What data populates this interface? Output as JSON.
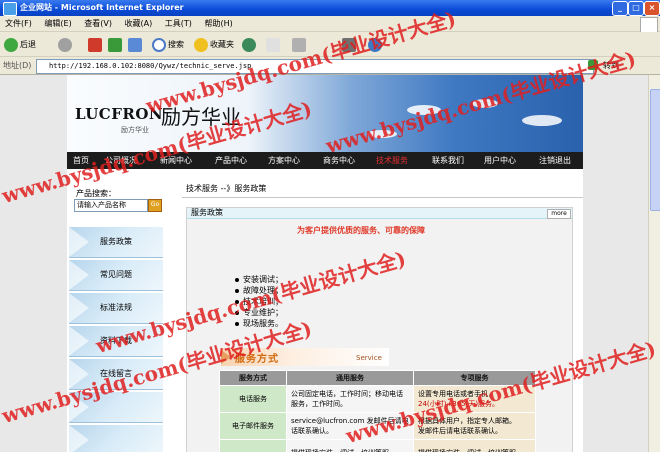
{
  "window": {
    "title": "企业网站 - Microsoft Internet Explorer"
  },
  "menubar": [
    "文件(F)",
    "编辑(E)",
    "查看(V)",
    "收藏(A)",
    "工具(T)",
    "帮助(H)"
  ],
  "toolbar": {
    "back": "后退",
    "search": "搜索",
    "favorites": "收藏夹"
  },
  "address": {
    "label": "地址(D)",
    "url": "http://192.168.0.102:8080/Qywz/technic_serve.jsp",
    "go": "转到"
  },
  "site": {
    "logo_en": "LUCFRON",
    "logo_cn": "励方华业",
    "logo_sub": "励方华业",
    "nav": [
      "首页",
      "公司概况",
      "新闻中心",
      "产品中心",
      "方案中心",
      "商务中心",
      "技术服务",
      "联系我们",
      "用户中心",
      "注销退出"
    ],
    "search_label": "产品搜索：",
    "search_placeholder": "请输入产品名称",
    "search_go": "Go",
    "sidebar": [
      "服务政策",
      "常见问题",
      "标准法规",
      "资料下载",
      "在线留言"
    ],
    "breadcrumb": "技术服务 --》服务政策",
    "panel_title": "服务政策",
    "more": "more",
    "slogan": "为客户提供优质的服务、可靠的保障",
    "services": [
      "安装调试；",
      "故障处理；",
      "技术培训；",
      "专业维护；",
      "现场服务。"
    ],
    "svc_banner_cn": "服务方式",
    "svc_banner_en": "Service",
    "table": {
      "headers": [
        "服务方式",
        "通用服务",
        "专项服务"
      ],
      "rows": [
        {
          "method": "电话服务",
          "general": "公司固定电话，工作时间；移动电话服务，工作时间。",
          "special_a": "设置专用电话或者手机，",
          "special_b": "24(小时)+365(天)服务。"
        },
        {
          "method": "电子邮件服务",
          "general": "service@lucfron.com 发邮件后请电话联系确认。",
          "special_a": "根据具体用户，指定专人邮箱。",
          "special_b": "发邮件后请电话联系确认。"
        },
        {
          "method": "",
          "general": "提供现场安装、调试、培训等服",
          "special_a": "提供现场安装、调试、培训等服",
          "special_b": ""
        }
      ]
    }
  },
  "watermark": "www.bysjdq.com(毕业设计大全)"
}
